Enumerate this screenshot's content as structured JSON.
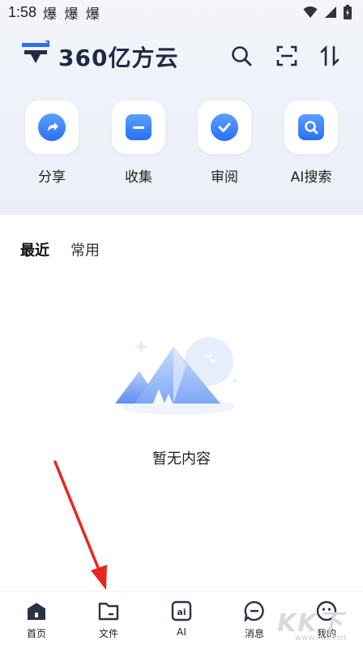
{
  "status_bar": {
    "time": "1:58",
    "notifications": "爆 爆 爆"
  },
  "header": {
    "logo_text": "360亿方云",
    "icons": [
      "search-icon",
      "scan-icon",
      "sort-icon"
    ]
  },
  "quick_actions": [
    {
      "label": "分享",
      "icon": "share-icon"
    },
    {
      "label": "收集",
      "icon": "collect-icon"
    },
    {
      "label": "审阅",
      "icon": "review-icon"
    },
    {
      "label": "AI搜索",
      "icon": "ai-search-icon"
    }
  ],
  "tabs": [
    {
      "label": "最近",
      "active": true
    },
    {
      "label": "常用",
      "active": false
    }
  ],
  "empty_state": {
    "text": "暂无内容"
  },
  "bottom_nav": [
    {
      "label": "首页",
      "icon": "home-icon"
    },
    {
      "label": "文件",
      "icon": "folder-icon"
    },
    {
      "label": "AI",
      "icon": "ai-icon"
    },
    {
      "label": "消息",
      "icon": "message-icon"
    },
    {
      "label": "我的",
      "icon": "profile-icon"
    }
  ],
  "watermark": {
    "text": "KK下载",
    "url": "www.kkx.net"
  },
  "colors": {
    "accent": "#2a6ff2",
    "arrow": "#e8261f"
  }
}
